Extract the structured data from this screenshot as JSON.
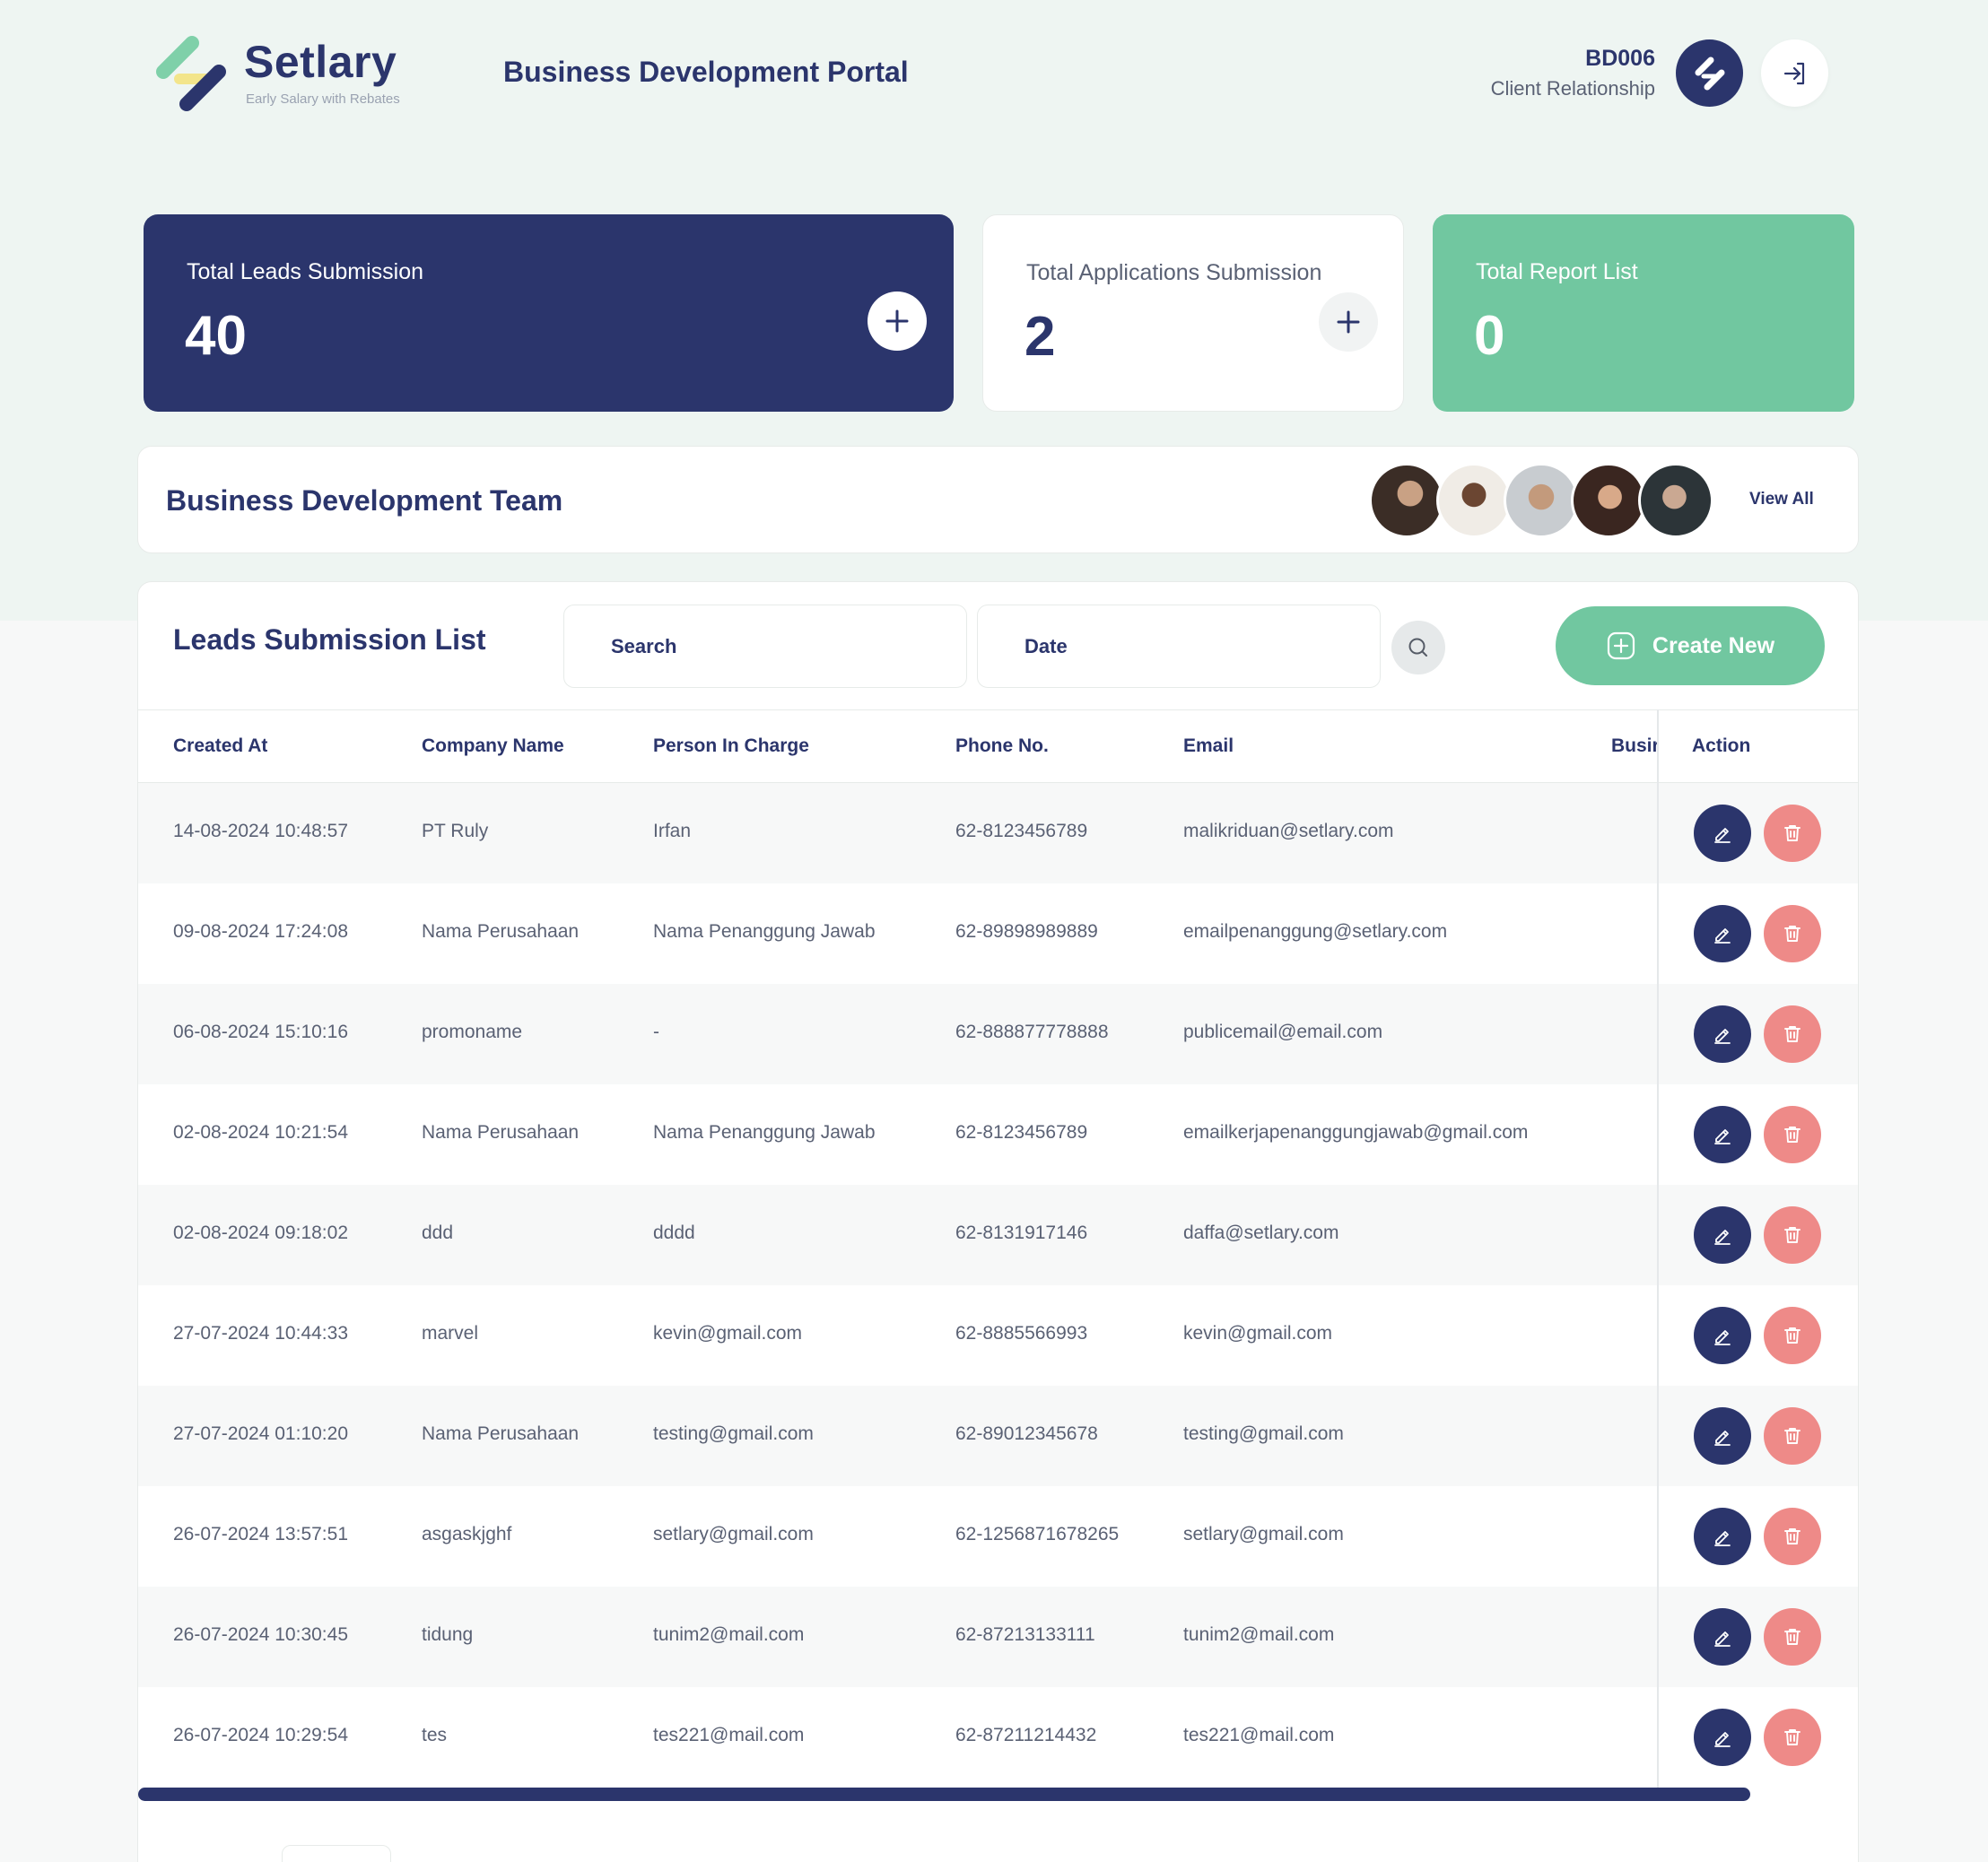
{
  "colors": {
    "primary": "#2b356c",
    "accent_green": "#71c7a0",
    "delete_red": "#ee8a88",
    "page_bg_top": "#eef5f2"
  },
  "brand": {
    "name": "Setlary",
    "tagline": "Early Salary with Rebates"
  },
  "header": {
    "portal_title": "Business Development Portal",
    "user_id": "BD006",
    "user_role": "Client Relationship",
    "logout_icon": "logout-icon"
  },
  "stats": {
    "leads": {
      "label": "Total Leads Submission",
      "value": "40"
    },
    "applications": {
      "label": "Total Applications Submission",
      "value": "2"
    },
    "reports": {
      "label": "Total Report List",
      "value": "0"
    }
  },
  "team": {
    "title": "Business Development Team",
    "view_all": "View All",
    "member_count": 5
  },
  "leads_panel": {
    "title": "Leads Submission List",
    "search_placeholder": "Search",
    "date_placeholder": "Date",
    "create_label": "Create New"
  },
  "table": {
    "columns": [
      "Created At",
      "Company Name",
      "Person In Charge",
      "Phone No.",
      "Email",
      "Busir",
      "Action"
    ],
    "rows": [
      {
        "created_at": "14-08-2024 10:48:57",
        "company": "PT Ruly",
        "pic": "Irfan",
        "phone": "62-8123456789",
        "email": "malikriduan@setlary.com"
      },
      {
        "created_at": "09-08-2024 17:24:08",
        "company": "Nama Perusahaan",
        "pic": "Nama Penanggung Jawab",
        "phone": "62-89898989889",
        "email": "emailpenanggung@setlary.com"
      },
      {
        "created_at": "06-08-2024 15:10:16",
        "company": "promoname",
        "pic": "-",
        "phone": "62-888877778888",
        "email": "publicemail@email.com"
      },
      {
        "created_at": "02-08-2024 10:21:54",
        "company": "Nama Perusahaan",
        "pic": "Nama Penanggung Jawab",
        "phone": "62-8123456789",
        "email": "emailkerjapenanggungjawab@gmail.com"
      },
      {
        "created_at": "02-08-2024 09:18:02",
        "company": "ddd",
        "pic": "dddd",
        "phone": "62-8131917146",
        "email": "daffa@setlary.com"
      },
      {
        "created_at": "27-07-2024 10:44:33",
        "company": "marvel",
        "pic": "kevin@gmail.com",
        "phone": "62-8885566993",
        "email": "kevin@gmail.com"
      },
      {
        "created_at": "27-07-2024 01:10:20",
        "company": "Nama Perusahaan",
        "pic": "testing@gmail.com",
        "phone": "62-89012345678",
        "email": "testing@gmail.com"
      },
      {
        "created_at": "26-07-2024 13:57:51",
        "company": "asgaskjghf",
        "pic": "setlary@gmail.com",
        "phone": "62-1256871678265",
        "email": "setlary@gmail.com"
      },
      {
        "created_at": "26-07-2024 10:30:45",
        "company": "tidung",
        "pic": "tunim2@mail.com",
        "phone": "62-87213133111",
        "email": "tunim2@mail.com"
      },
      {
        "created_at": "26-07-2024 10:29:54",
        "company": "tes",
        "pic": "tes221@mail.com",
        "phone": "62-87211214432",
        "email": "tes221@mail.com"
      }
    ]
  }
}
